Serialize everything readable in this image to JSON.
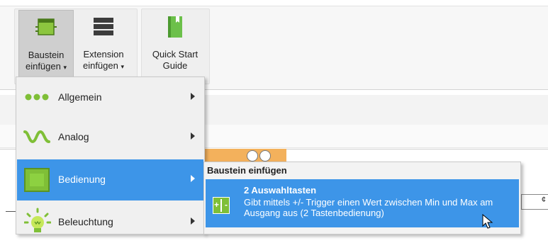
{
  "ribbon": {
    "buttons": [
      {
        "line1": "Baustein",
        "line2": "einfügen",
        "has_caret": true,
        "icon": "module-window-icon"
      },
      {
        "line1": "Extension",
        "line2": "einfügen",
        "has_caret": true,
        "icon": "extension-icon"
      },
      {
        "line1": "Quick Start",
        "line2": "Guide",
        "has_caret": false,
        "icon": "book-icon"
      }
    ],
    "caret": "▾"
  },
  "menu": {
    "items": [
      {
        "label": "Allgemein",
        "icon": "three-dots-icon"
      },
      {
        "label": "Analog",
        "icon": "sine-wave-icon"
      },
      {
        "label": "Bedienung",
        "icon": "green-square-icon",
        "active": true
      },
      {
        "label": "Beleuchtung",
        "icon": "light-bulb-icon"
      }
    ]
  },
  "submenu": {
    "header": "Baustein einfügen",
    "items": [
      {
        "title": "2 Auswahltasten",
        "description": "Gibt mittels +/- Trigger einen Wert zwischen Min und Max am Ausgang aus (2 Tastenbedienung)",
        "icon": "plus-minus-buttons-icon",
        "plus": "+",
        "minus": "-"
      }
    ]
  },
  "field_right_text": "¢",
  "colors": {
    "highlight": "#3d95e8",
    "green": "#7fbf37",
    "orange": "#f3b15c"
  }
}
